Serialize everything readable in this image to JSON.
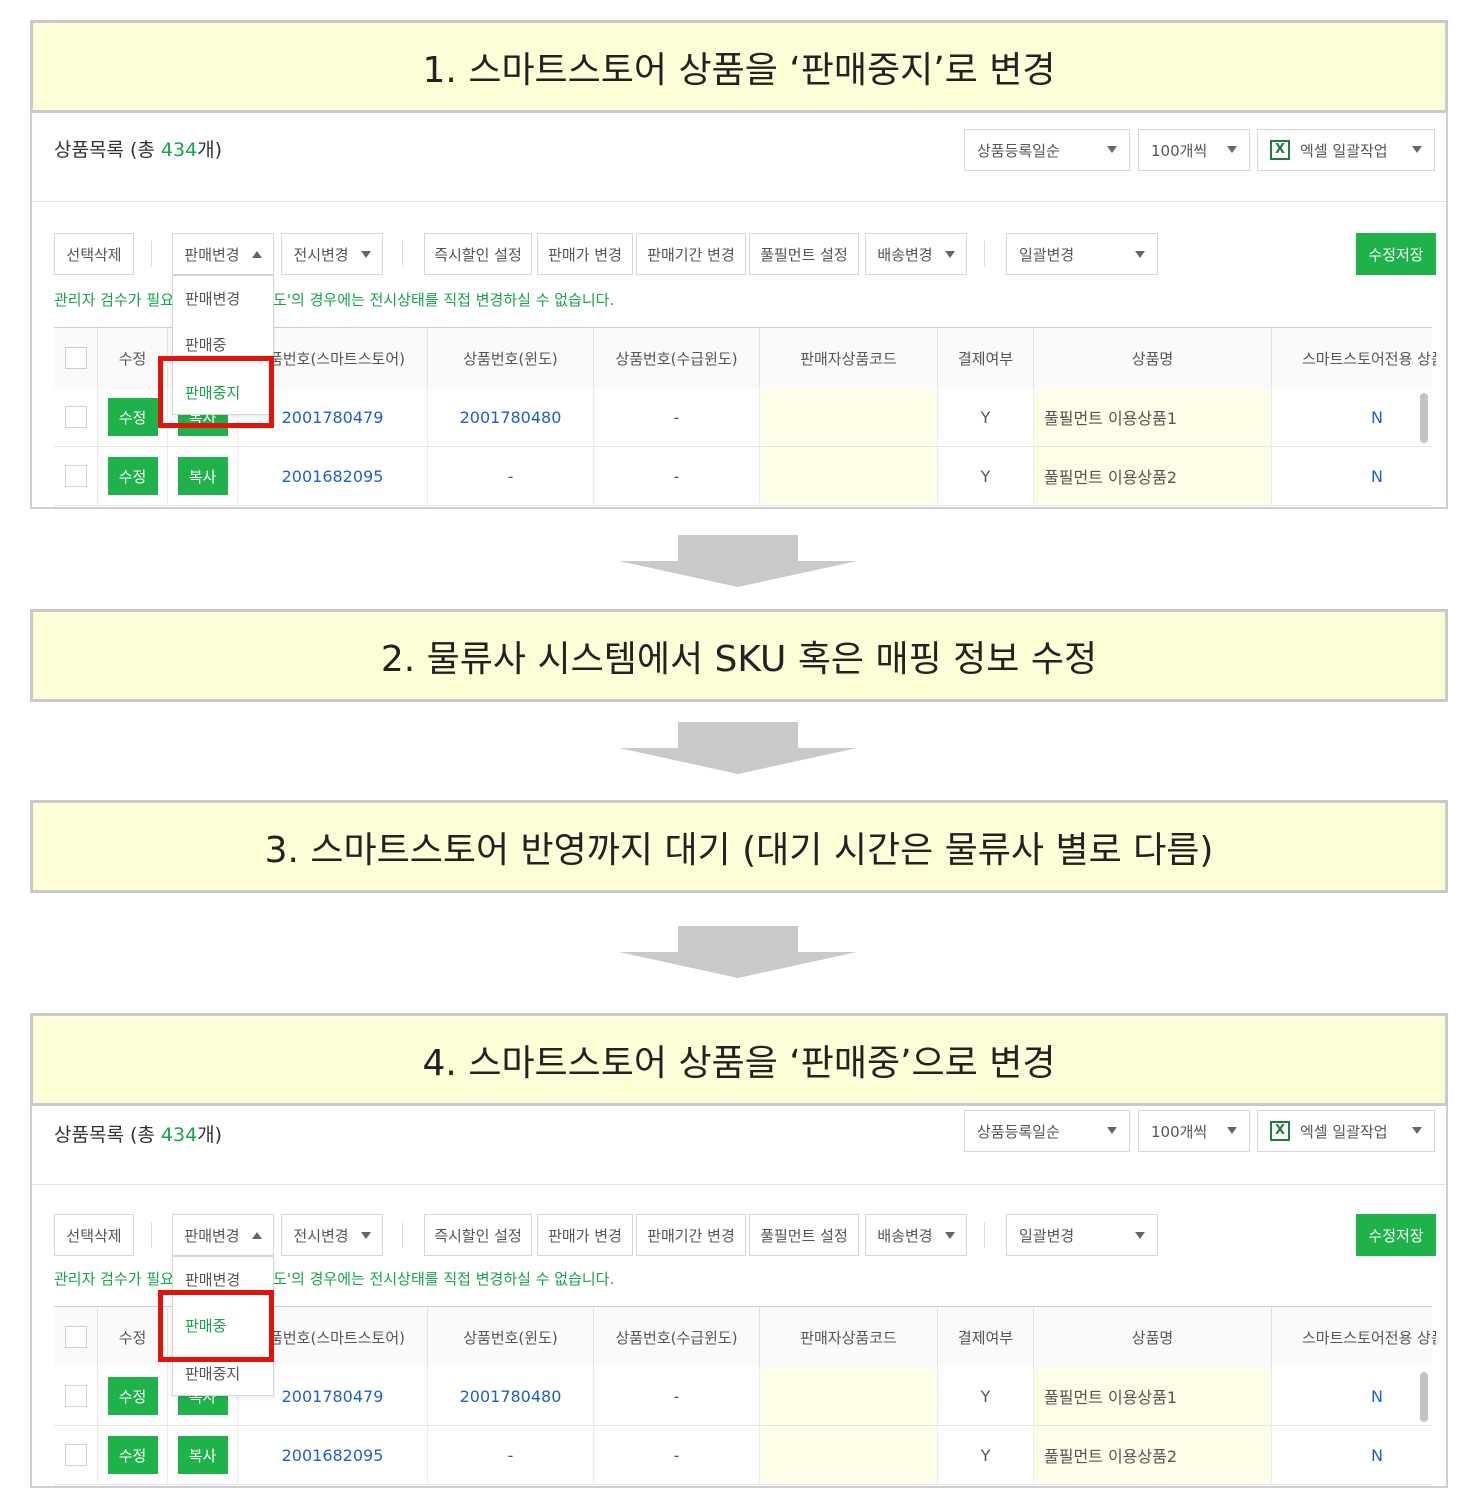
{
  "steps": [
    "1. 스마트스토어 상품을 ‘판매중지’로 변경",
    "2. 물류사 시스템에서 SKU 혹은 매핑 정보 수정",
    "3. 스마트스토어 반영까지 대기 (대기 시간은 물류사 별로 다름)",
    "4. 스마트스토어 상품을 ‘판매중’으로 변경"
  ],
  "list_title": {
    "prefix": "상품목록 (총 ",
    "count": "434",
    "suffix": "개)"
  },
  "sort_select": "상품등록일순",
  "page_size_select": "100개씩",
  "excel_select": "엑셀 일괄작업",
  "excel_icon": "excel-icon",
  "toolbar": {
    "delete": "선택삭제",
    "sale_change": "판매변경",
    "display_change": "전시변경",
    "instant_discount": "즉시할인 설정",
    "price_change": "판매가 변경",
    "period_change": "판매기간 변경",
    "fulfillment": "풀필먼트 설정",
    "delivery_change": "배송변경",
    "bulk_change": "일괄변경",
    "save": "수정저장"
  },
  "notice_left": "관리자 검수가 필요",
  "notice_right": "'도'의 경우에는 전시상태를 직접 변경하실 수 없습니다.",
  "table": {
    "headers": [
      "수정",
      "상품번호(스마트스토어)",
      "상품번호(윈도)",
      "상품번호(수급윈도)",
      "판매자상품코드",
      "결제여부",
      "상품명",
      "스마트스토어전용 상품"
    ],
    "rows": [
      {
        "edit": "수정",
        "copy": "복사",
        "store_id": "2001780479",
        "window_id": "2001780480",
        "supply_id": "-",
        "seller_code": "",
        "paid": "Y",
        "name": "풀필먼트 이용상품1",
        "exclusive": "N"
      },
      {
        "edit": "수정",
        "copy": "복사",
        "store_id": "2001682095",
        "window_id": "-",
        "supply_id": "-",
        "seller_code": "",
        "paid": "Y",
        "name": "풀필먼트 이용상품2",
        "exclusive": "N"
      }
    ]
  },
  "dropdown_top": {
    "header": "판매변경",
    "items": [
      "판매중",
      "판매중지"
    ],
    "selected": "판매중지"
  },
  "dropdown_bottom": {
    "header": "판매변경",
    "items": [
      "판매중",
      "판매중지"
    ],
    "selected": "판매중"
  },
  "colors": {
    "banner_bg": "#fdfdd8",
    "accent_green": "#1fb24b",
    "highlight_red": "#e3120b",
    "link_blue": "#1f5fc8"
  }
}
